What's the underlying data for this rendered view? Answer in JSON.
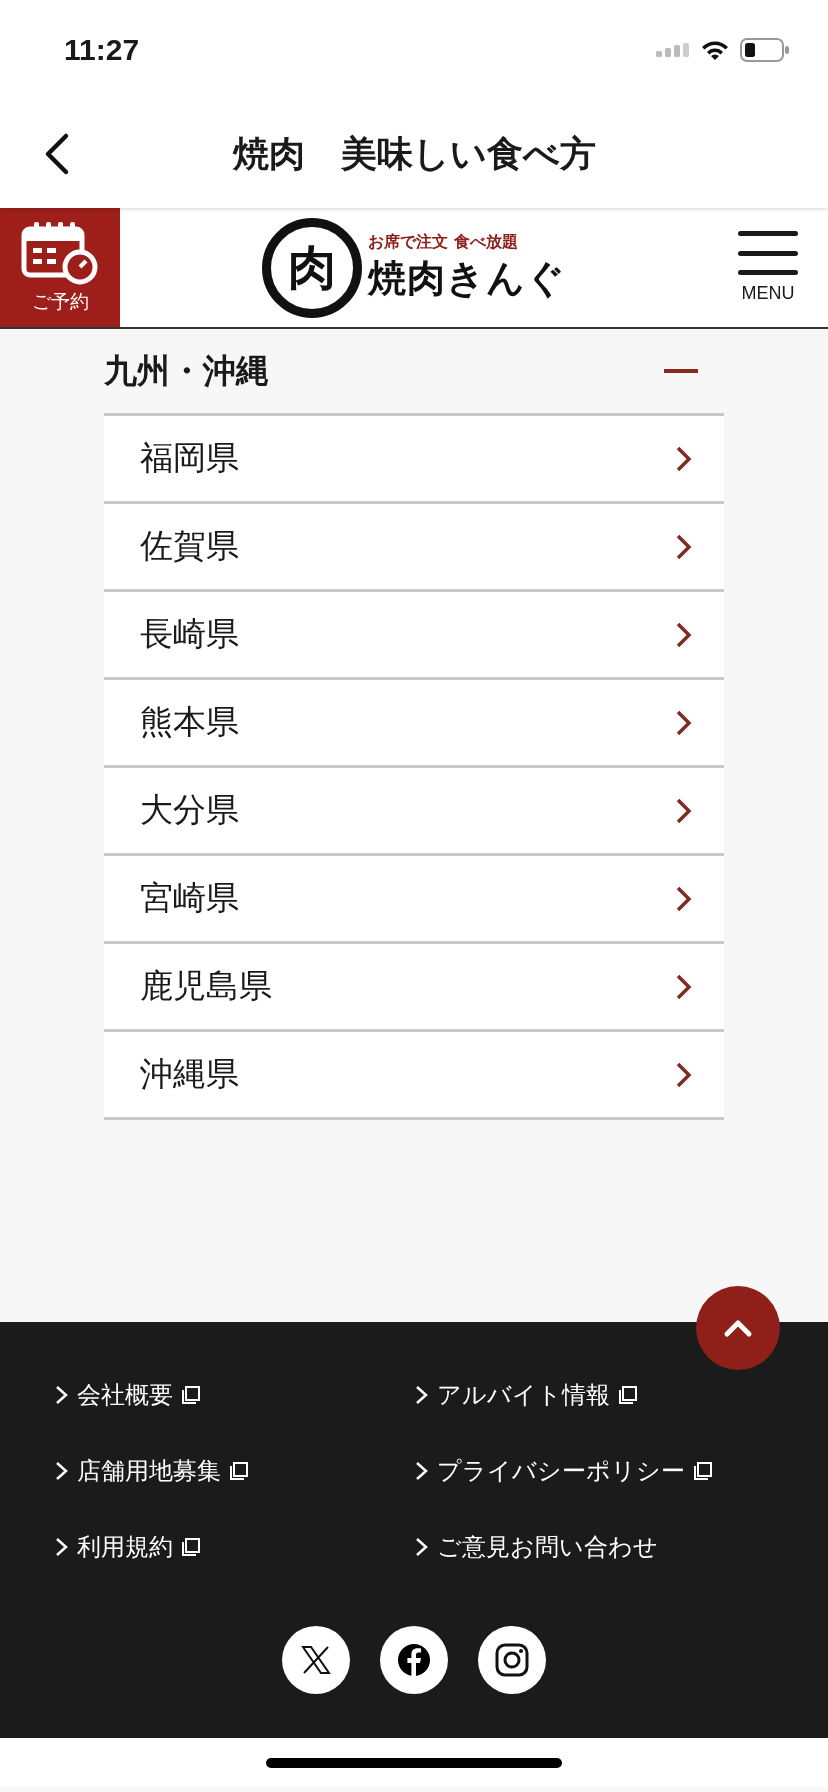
{
  "status_bar": {
    "time": "11:27"
  },
  "nav_bar": {
    "title": "焼肉　美味しい食べ方"
  },
  "site_header": {
    "reserve_label": "ご予約",
    "logo": {
      "mark": "肉",
      "tagline": "お席で注文 食べ放題",
      "name": "焼肉きんぐ"
    },
    "menu_label": "MENU"
  },
  "region": {
    "title": "九州・沖縄",
    "expanded": true,
    "items": [
      {
        "label": "福岡県"
      },
      {
        "label": "佐賀県"
      },
      {
        "label": "長崎県"
      },
      {
        "label": "熊本県"
      },
      {
        "label": "大分県"
      },
      {
        "label": "宮崎県"
      },
      {
        "label": "鹿児島県"
      },
      {
        "label": "沖縄県"
      }
    ]
  },
  "footer": {
    "links": [
      {
        "label": "会社概要",
        "external": true
      },
      {
        "label": "アルバイト情報",
        "external": true
      },
      {
        "label": "店舗用地募集",
        "external": true
      },
      {
        "label": "プライバシーポリシー",
        "external": true
      },
      {
        "label": "利用規約",
        "external": true
      },
      {
        "label": "ご意見お問い合わせ",
        "external": false
      }
    ],
    "social": [
      {
        "kind": "x"
      },
      {
        "kind": "facebook"
      },
      {
        "kind": "instagram"
      }
    ]
  }
}
